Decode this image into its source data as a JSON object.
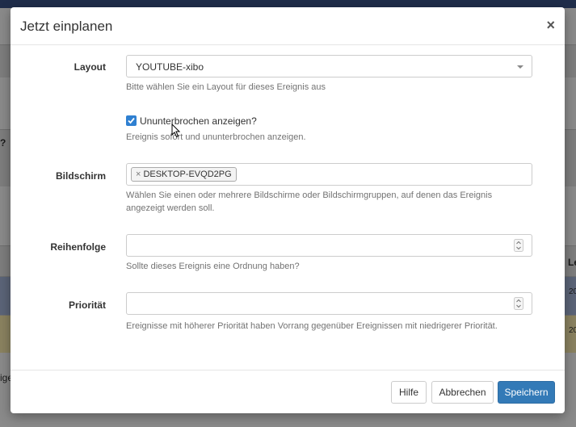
{
  "background": {
    "fragments": [
      "?",
      "Le",
      "20",
      "20",
      "ige"
    ]
  },
  "modal": {
    "title": "Jetzt einplanen",
    "close_label": "×",
    "layout": {
      "label": "Layout",
      "value": "YOUTUBE-xibo",
      "help": "Bitte wählen Sie ein Layout für dieses Ereignis aus"
    },
    "always_on": {
      "checked": true,
      "label": "Ununterbrochen anzeigen?",
      "help": "Ereignis sofort und ununterbrochen anzeigen."
    },
    "displays": {
      "label": "Bildschirm",
      "tags": [
        "DESKTOP-EVQD2PG"
      ],
      "tag_remove": "×",
      "help": "Wählen Sie einen oder mehrere Bildschirme oder Bildschirmgruppen, auf denen das Ereignis angezeigt werden soll."
    },
    "order": {
      "label": "Reihenfolge",
      "value": "",
      "help": "Sollte dieses Ereignis eine Ordnung haben?"
    },
    "priority": {
      "label": "Priorität",
      "value": "",
      "help": "Ereignisse mit höherer Priorität haben Vorrang gegenüber Ereignissen mit niedrigerer Priorität."
    },
    "buttons": {
      "help": "Hilfe",
      "cancel": "Abbrechen",
      "save": "Speichern"
    }
  },
  "colors": {
    "primary": "#337ab7",
    "checkbox": "#2f80d1",
    "overlay": "#8a8a8a"
  }
}
